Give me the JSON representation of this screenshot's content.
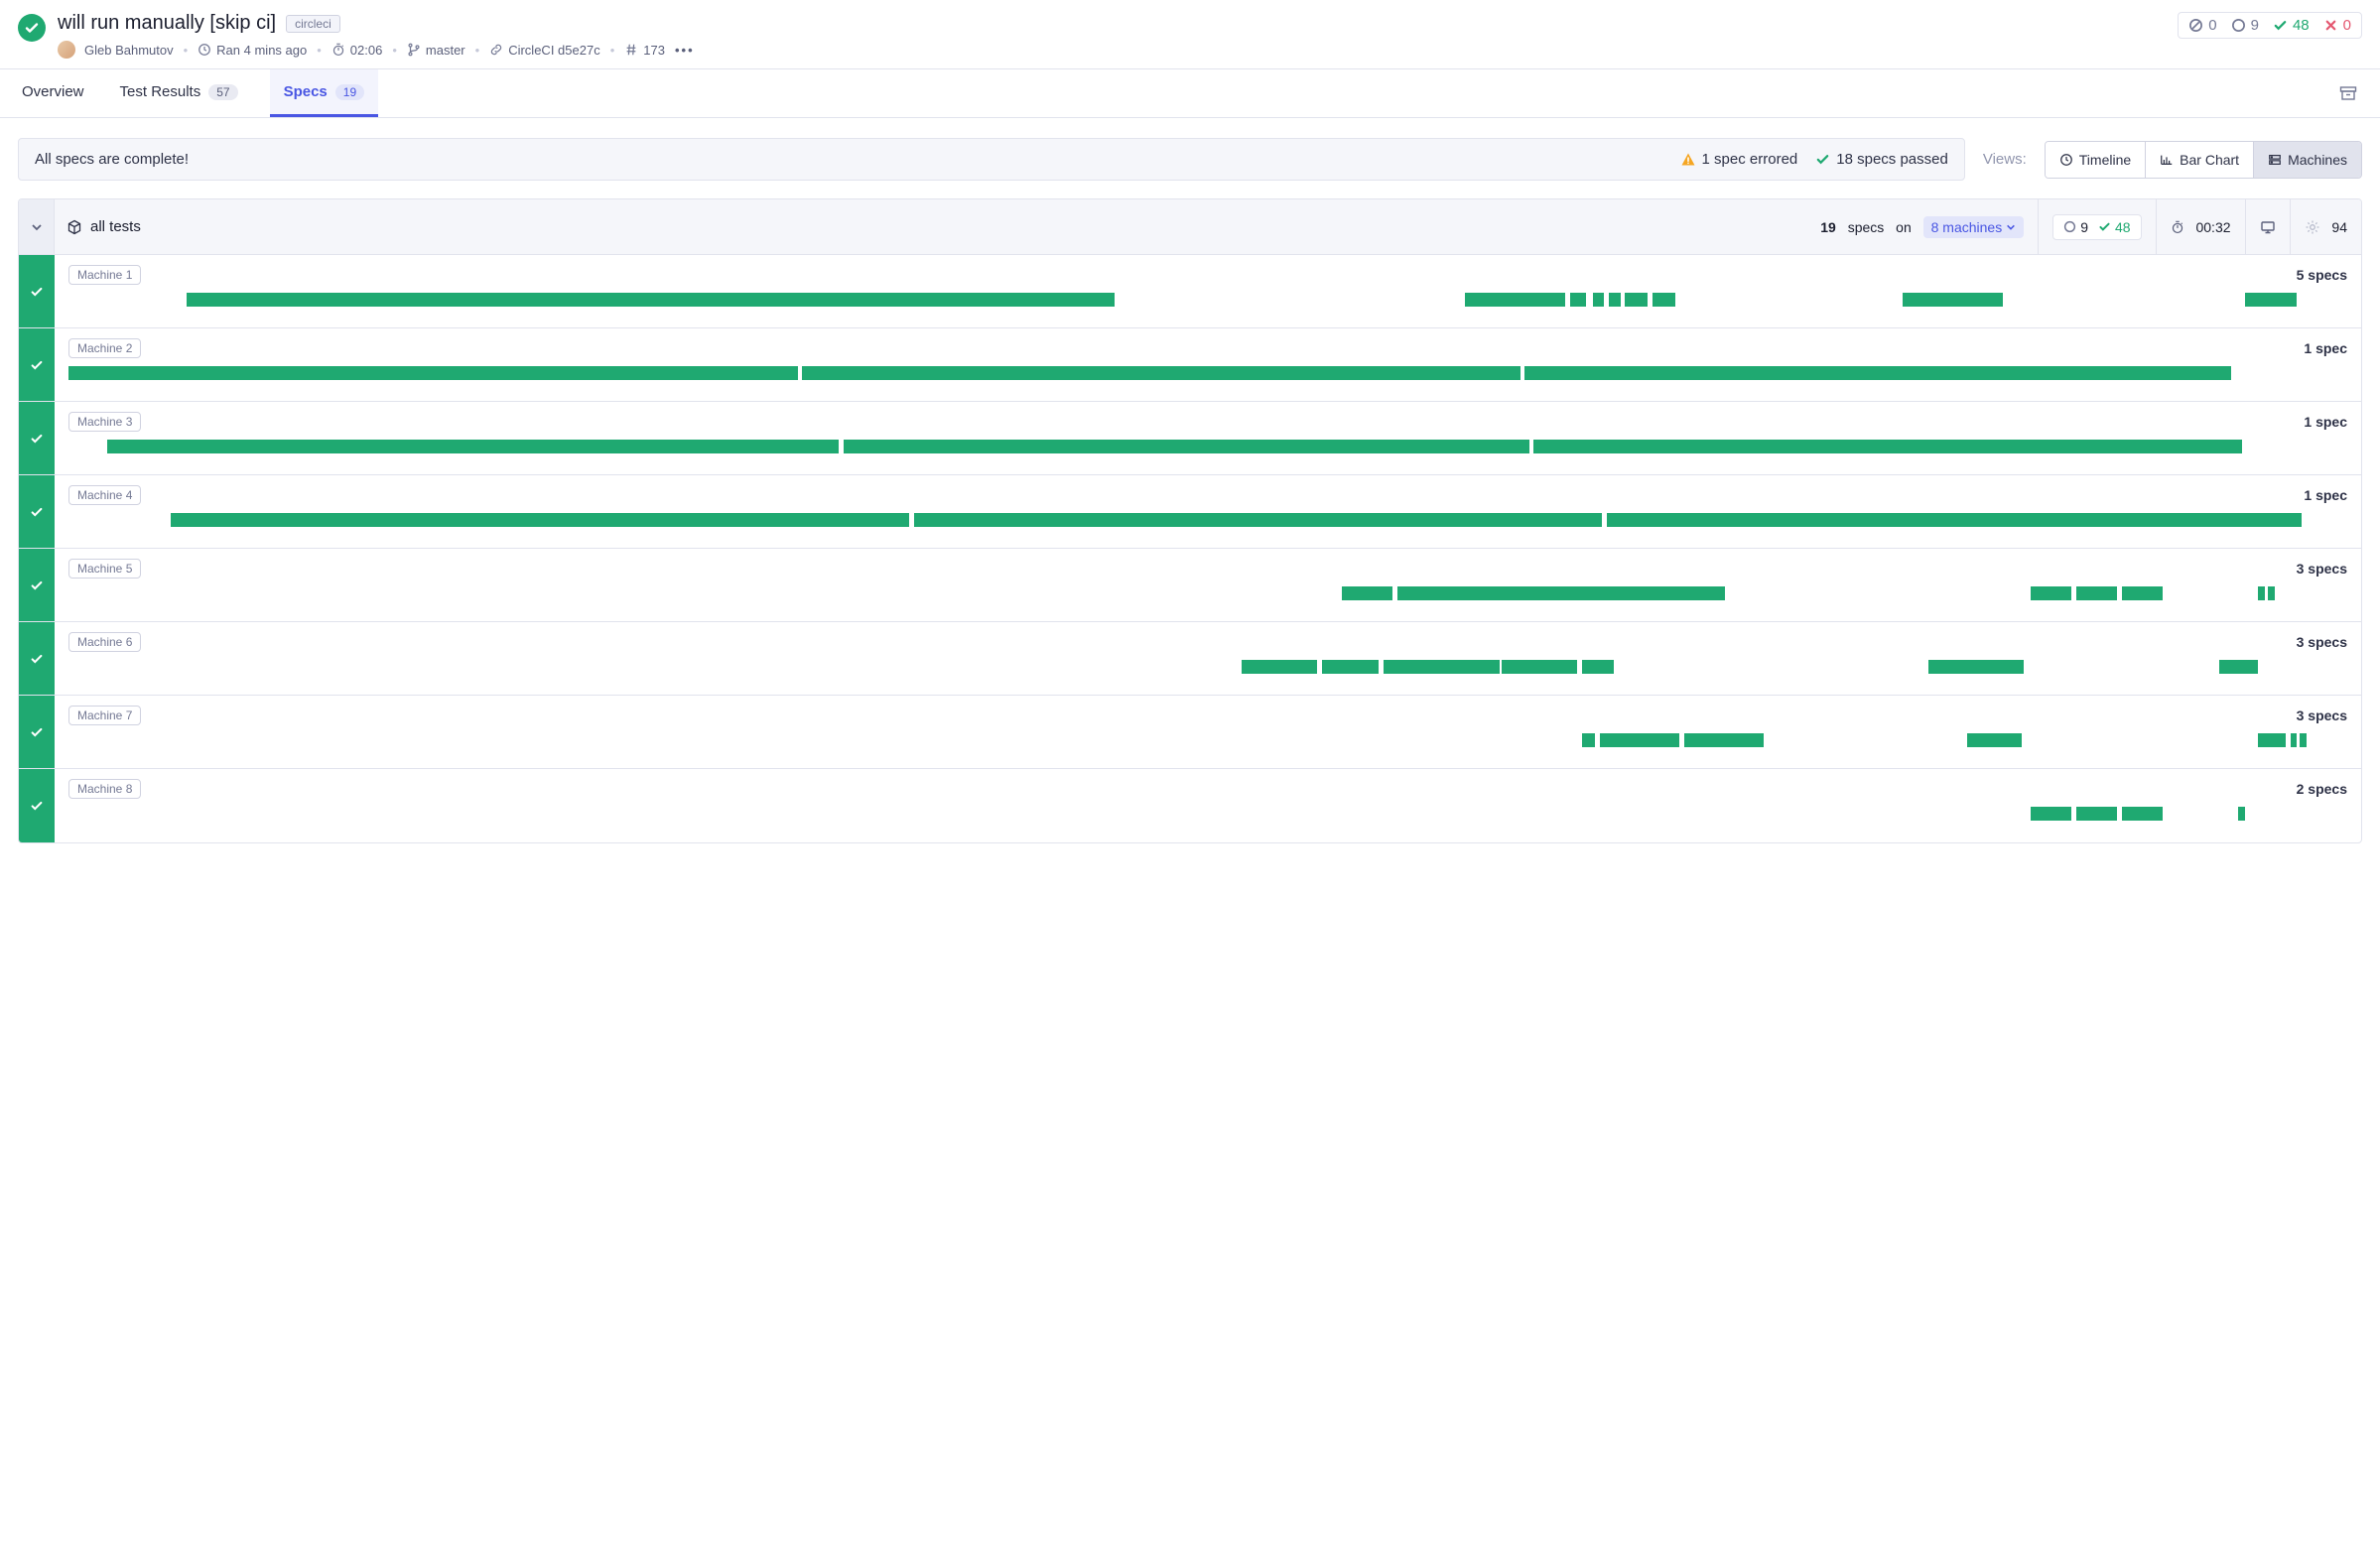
{
  "header": {
    "title": "will run manually [skip ci]",
    "tag": "circleci",
    "author": "Gleb Bahmutov",
    "ran": "Ran 4 mins ago",
    "duration": "02:06",
    "branch": "master",
    "ci": "CircleCI d5e27c",
    "build": "173",
    "stats": {
      "skipped": "0",
      "pending": "9",
      "passed": "48",
      "failed": "0"
    }
  },
  "tabs": {
    "overview": "Overview",
    "test_results": "Test Results",
    "test_results_count": "57",
    "specs": "Specs",
    "specs_count": "19"
  },
  "banner": {
    "msg": "All specs are complete!",
    "errored": "1 spec errored",
    "passed": "18 specs passed"
  },
  "views": {
    "label": "Views:",
    "timeline": "Timeline",
    "barchart": "Bar Chart",
    "machines": "Machines"
  },
  "all": {
    "label": "all tests",
    "specs_n": "19",
    "specs_word": "specs",
    "on_word": "on",
    "machines_n": "8 machines",
    "pending": "9",
    "passed": "48",
    "duration": "00:32",
    "snapshots": "94"
  },
  "machines": [
    {
      "name": "Machine 1",
      "specs": "5 specs",
      "segs": [
        [
          5.2,
          40.7
        ],
        [
          61.3,
          4.4
        ],
        [
          65.9,
          0.7
        ],
        [
          66.9,
          0.5
        ],
        [
          67.6,
          0.5
        ],
        [
          68.3,
          1.0
        ],
        [
          69.5,
          1.0
        ],
        [
          80.5,
          4.4
        ],
        [
          95.5,
          2.3
        ]
      ]
    },
    {
      "name": "Machine 2",
      "specs": "1 spec",
      "segs": [
        [
          0,
          32.0
        ],
        [
          32.2,
          31.5
        ],
        [
          63.9,
          31.0
        ]
      ]
    },
    {
      "name": "Machine 3",
      "specs": "1 spec",
      "segs": [
        [
          1.7,
          32.1
        ],
        [
          34.0,
          30.1
        ],
        [
          64.3,
          31.1
        ]
      ]
    },
    {
      "name": "Machine 4",
      "specs": "1 spec",
      "segs": [
        [
          4.5,
          32.4
        ],
        [
          37.1,
          30.2
        ],
        [
          67.5,
          30.5
        ]
      ]
    },
    {
      "name": "Machine 5",
      "specs": "3 specs",
      "segs": [
        [
          55.9,
          2.2
        ],
        [
          58.3,
          14.4
        ],
        [
          86.1,
          1.8
        ],
        [
          88.1,
          1.8
        ],
        [
          90.1,
          1.8
        ],
        [
          96.1,
          0.3
        ],
        [
          96.5,
          0.3
        ]
      ]
    },
    {
      "name": "Machine 6",
      "specs": "3 specs",
      "segs": [
        [
          51.5,
          3.3
        ],
        [
          55.0,
          2.5
        ],
        [
          57.7,
          5.1
        ],
        [
          62.9,
          3.3
        ],
        [
          66.4,
          1.4
        ],
        [
          81.6,
          4.2
        ],
        [
          94.4,
          1.7
        ]
      ]
    },
    {
      "name": "Machine 7",
      "specs": "3 specs",
      "segs": [
        [
          66.4,
          0.6
        ],
        [
          67.2,
          3.5
        ],
        [
          70.9,
          3.5
        ],
        [
          83.3,
          2.4
        ],
        [
          96.1,
          1.2
        ],
        [
          97.5,
          0.3
        ],
        [
          97.9,
          0.3
        ]
      ]
    },
    {
      "name": "Machine 8",
      "specs": "2 specs",
      "segs": [
        [
          86.1,
          1.8
        ],
        [
          88.1,
          1.8
        ],
        [
          90.1,
          1.8
        ],
        [
          95.2,
          0.3
        ]
      ]
    }
  ]
}
